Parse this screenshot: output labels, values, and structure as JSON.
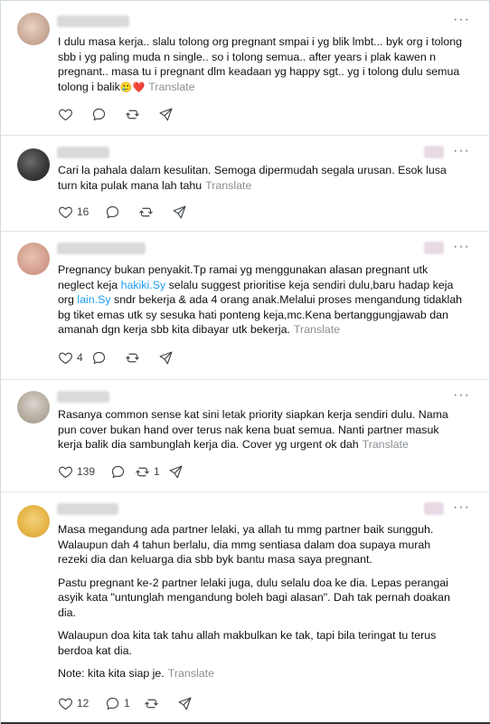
{
  "posts": [
    {
      "text": "I dulu masa kerja.. slalu tolong org pregnant smpai i yg blik lmbt... byk org i tolong sbb i yg paling muda n single.. so i tolong semua.. after years i plak kawen n pregnant.. masa tu i pregnant dlm keadaan yg happy sgt.. yg i tolong dulu semua tolong i balik",
      "emoji": "🥲❤️",
      "translate": "Translate",
      "reply_count": "",
      "like_count": ""
    },
    {
      "text": "Cari la pahala dalam kesulitan. Semoga dipermudah segala urusan. Esok lusa turn kita pulak mana lah tahu",
      "translate": "Translate",
      "like_count": "16"
    },
    {
      "text_a": "Pregnancy bukan penyakit.Tp ramai yg menggunakan alasan pregnant utk neglect keja ",
      "link_a": "hakiki.Sy",
      "text_b": " selalu suggest prioritise keja sendiri dulu,baru hadap keja org ",
      "link_b": "lain.Sy",
      "text_c": " sndr bekerja & ada 4 orang anak.Melalui proses mengandung tidaklah bg tiket emas utk sy sesuka hati ponteng keja,mc.Kena bertanggungjawab dan amanah dgn kerja sbb kita dibayar utk bekerja.",
      "translate": "Translate",
      "like_count": "4"
    },
    {
      "text": "Rasanya common sense kat sini letak priority siapkan kerja sendiri dulu. Nama pun cover bukan hand over terus nak kena buat semua. Nanti partner masuk kerja balik dia sambunglah kerja dia. Cover yg urgent ok dah",
      "translate": "Translate",
      "like_count": "139",
      "repost_count": "1"
    },
    {
      "p1": "Masa megandung ada partner lelaki, ya allah tu mmg partner baik sungguh. Walaupun dah 4 tahun berlalu, dia mmg sentiasa dalam doa supaya murah rezeki dia dan keluarga dia sbb byk bantu masa saya pregnant.",
      "p2": "Pastu pregnant ke-2 partner lelaki juga, dulu selalu doa ke dia. Lepas perangai asyik kata \"untunglah mengandung boleh bagi alasan\". Dah tak pernah doakan dia.",
      "p3": "Walaupun doa kita tak tahu allah makbulkan ke tak, tapi bila teringat tu terus berdoa kat dia.",
      "p4": "Note: kita kita siap je.",
      "translate": "Translate",
      "like_count": "12",
      "reply_count": "1"
    }
  ],
  "ui": {
    "more": "···"
  },
  "colors": {
    "link": "#1d9bf0",
    "translate": "#8a8f94",
    "heart": "#e0245e"
  },
  "icons": [
    "heart-icon",
    "reply-icon",
    "repost-icon",
    "share-icon",
    "more-icon"
  ]
}
